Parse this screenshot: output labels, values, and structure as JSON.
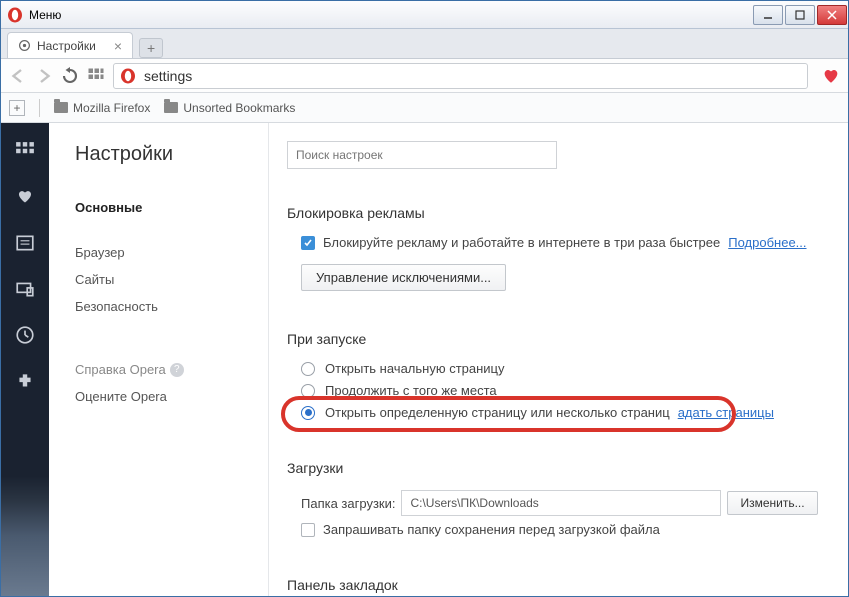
{
  "titlebar": {
    "menu": "Меню"
  },
  "tab": {
    "title": "Настройки"
  },
  "url": {
    "value": "settings"
  },
  "bookmarks": {
    "folder1": "Mozilla Firefox",
    "folder2": "Unsorted Bookmarks"
  },
  "sidebar": {
    "title": "Настройки",
    "items": [
      "Основные",
      "Браузер",
      "Сайты",
      "Безопасность"
    ],
    "help": "Справка Opera",
    "rate": "Оцените Opera"
  },
  "main": {
    "search_placeholder": "Поиск настроек",
    "adblock": {
      "title": "Блокировка рекламы",
      "checkbox": "Блокируйте рекламу и работайте в интернете в три раза быстрее",
      "learn_more": "Подробнее...",
      "manage": "Управление исключениями..."
    },
    "startup": {
      "title": "При запуске",
      "opt1": "Открыть начальную страницу",
      "opt2": "Продолжить с того же места",
      "opt3": "Открыть определенную страницу или несколько страниц",
      "set_pages": "адать страницы"
    },
    "downloads": {
      "title": "Загрузки",
      "folder_label": "Папка загрузки:",
      "folder_value": "C:\\Users\\ПК\\Downloads",
      "change": "Изменить...",
      "ask": "Запрашивать папку сохранения перед загрузкой файла"
    },
    "bookmarks_panel": {
      "title": "Панель закладок"
    }
  }
}
